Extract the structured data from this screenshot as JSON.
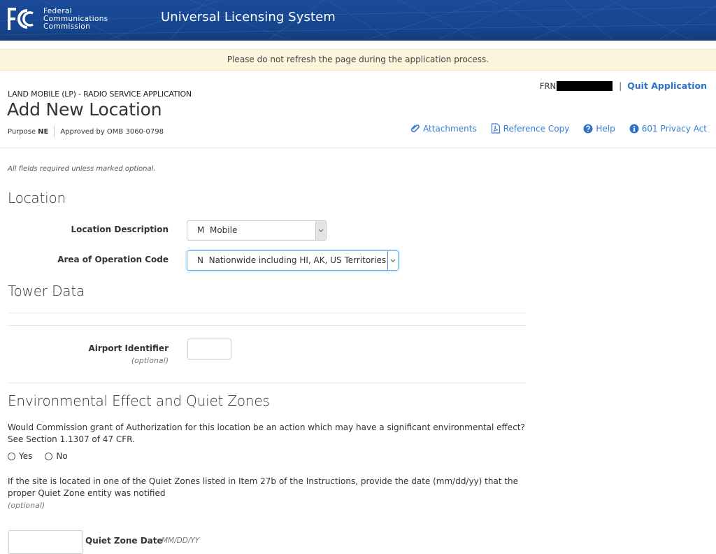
{
  "header": {
    "agency_line1": "Federal",
    "agency_line2": "Communications",
    "agency_line3": "Commission",
    "logo_icon": "fcc-logo-icon",
    "app_title": "Universal Licensing System"
  },
  "notice": {
    "text": "Please do not refresh the page during the application process."
  },
  "meta": {
    "service_line": "LAND MOBILE (LP) - RADIO SERVICE APPLICATION",
    "page_title": "Add New Location",
    "purpose_label": "Purpose",
    "purpose_code": "NE",
    "omb_text": "Approved by OMB 3060-0798",
    "frn_label": "FRN",
    "frn_value_redacted": true,
    "separator": "|",
    "quit_label": "Quit Application"
  },
  "actions": [
    {
      "label": "Attachments",
      "icon": "paperclip-icon"
    },
    {
      "label": "Reference Copy",
      "icon": "pdf-file-icon"
    },
    {
      "label": "Help",
      "icon": "question-circle-icon"
    },
    {
      "label": "601 Privacy Act",
      "icon": "info-circle-icon"
    }
  ],
  "form": {
    "required_note": "All fields required unless marked optional.",
    "location": {
      "title": "Location",
      "location_description_label": "Location Description",
      "location_description_value": "M  Mobile",
      "area_code_label": "Area of Operation Code",
      "area_code_value": "N  Nationwide including HI, AK, US Territories"
    },
    "tower": {
      "title": "Tower Data",
      "airport_label": "Airport Identifier",
      "airport_optional": "(optional)",
      "airport_value": ""
    },
    "environment": {
      "title": "Environmental Effect and Quiet Zones",
      "question": "Would Commission grant of Authorization for this location be an action which may have a significant environmental effect? See Section 1.1307 of 47 CFR.",
      "options": [
        "Yes",
        "No"
      ],
      "selected": null,
      "quiet_zone_text": "If the site is located in one of the Quiet Zones listed in Item 27b of the Instructions, provide the date (mm/dd/yy) that the proper Quiet Zone entity was notified",
      "quiet_zone_optional": "(optional)",
      "quiet_zone_label": "Quiet Zone Date",
      "quiet_zone_hint": "MM/DD/YY",
      "quiet_zone_value": ""
    }
  },
  "colors": {
    "header_blue": "#17468f",
    "link_blue": "#3a7bd5",
    "notice_bg": "#fcf5dc",
    "focus_blue": "#66afe9"
  }
}
